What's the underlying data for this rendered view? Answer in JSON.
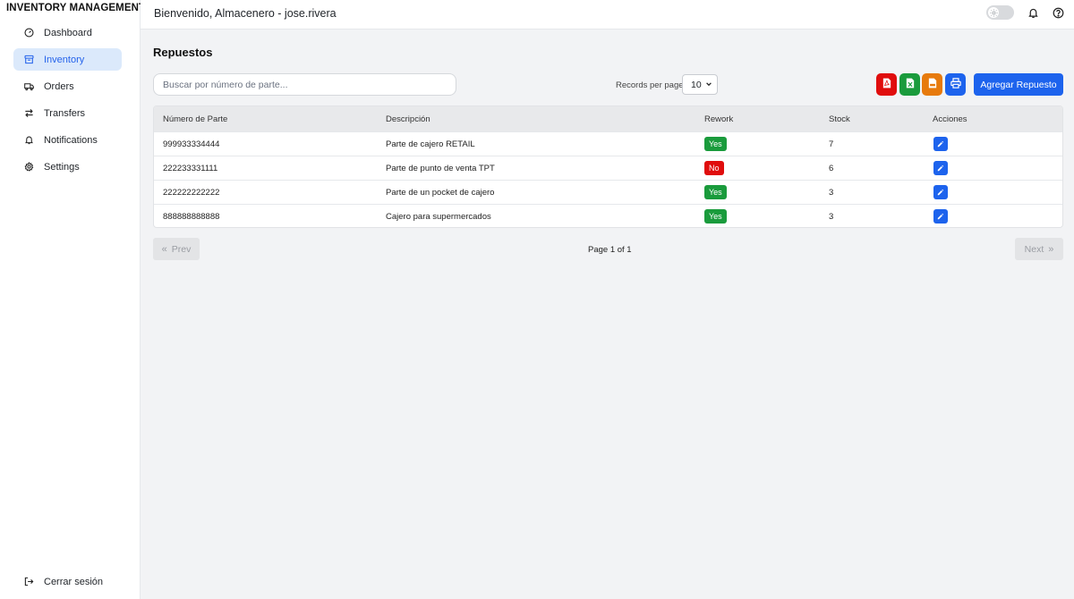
{
  "app": {
    "brand": "INVENTORY MANAGEMENT"
  },
  "sidebar": {
    "items": [
      {
        "label": "Dashboard",
        "icon": "dashboard-icon",
        "active": false
      },
      {
        "label": "Inventory",
        "icon": "archive-icon",
        "active": true
      },
      {
        "label": "Orders",
        "icon": "truck-icon",
        "active": false
      },
      {
        "label": "Transfers",
        "icon": "transfer-arrows-icon",
        "active": false
      },
      {
        "label": "Notifications",
        "icon": "bell-icon",
        "active": false
      },
      {
        "label": "Settings",
        "icon": "gear-icon",
        "active": false
      }
    ],
    "logout_label": "Cerrar sesión"
  },
  "header": {
    "welcome": "Bienvenido, Almacenero - jose.rivera",
    "theme_toggle_icon": "sun-icon",
    "notifications_icon": "bell-icon",
    "help_icon": "help-icon"
  },
  "main": {
    "title": "Repuestos",
    "search_placeholder": "Buscar por número de parte...",
    "records_per_page_label": "Records per page",
    "records_per_page_value": "10",
    "export_buttons": [
      {
        "name": "pdf-export",
        "icon": "pdf-file-icon",
        "color": "#e00d0d"
      },
      {
        "name": "excel-export",
        "icon": "excel-file-icon",
        "color": "#1a9b3c"
      },
      {
        "name": "csv-export",
        "icon": "csv-file-icon",
        "color": "#e77a0c"
      },
      {
        "name": "print",
        "icon": "printer-icon",
        "color": "#1d63ed"
      }
    ],
    "add_button_label": "Agregar Repuesto",
    "accent_color": "#1d63ed"
  },
  "table": {
    "columns": [
      "Número de Parte",
      "Descripción",
      "Rework",
      "Stock",
      "Acciones"
    ],
    "rows": [
      {
        "part": "999933334444",
        "desc": "Parte de cajero RETAIL",
        "rework": "Yes",
        "stock": "7"
      },
      {
        "part": "222233331111",
        "desc": "Parte de punto de venta TPT",
        "rework": "No",
        "stock": "6"
      },
      {
        "part": "222222222222",
        "desc": "Parte de un pocket de cajero",
        "rework": "Yes",
        "stock": "3"
      },
      {
        "part": "888888888888",
        "desc": "Cajero para supermercados",
        "rework": "Yes",
        "stock": "3"
      }
    ]
  },
  "pagination": {
    "prev_label": "Prev",
    "next_label": "Next",
    "page_info": "Page 1 of 1"
  }
}
